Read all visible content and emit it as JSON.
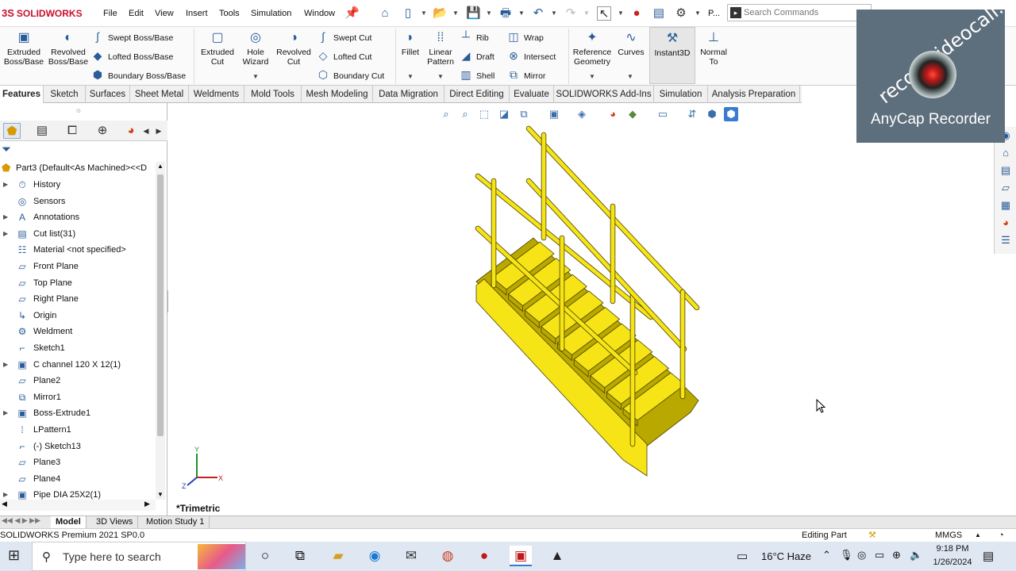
{
  "app": {
    "logo_prefix": "3S",
    "logo_text": "SOLIDWORKS"
  },
  "menu": [
    "File",
    "Edit",
    "View",
    "Insert",
    "Tools",
    "Simulation",
    "Window"
  ],
  "quick": {
    "truncated_label": "P...",
    "search_placeholder": "Search Commands"
  },
  "ribbon": {
    "extruded_boss": "Extruded\nBoss/Base",
    "revolved_boss": "Revolved\nBoss/Base",
    "swept_boss": "Swept Boss/Base",
    "lofted_boss": "Lofted Boss/Base",
    "boundary_boss": "Boundary Boss/Base",
    "extruded_cut": "Extruded\nCut",
    "hole_wizard": "Hole\nWizard",
    "revolved_cut": "Revolved\nCut",
    "swept_cut": "Swept Cut",
    "lofted_cut": "Lofted Cut",
    "boundary_cut": "Boundary Cut",
    "fillet": "Fillet",
    "linear_pattern": "Linear\nPattern",
    "rib": "Rib",
    "draft": "Draft",
    "shell": "Shell",
    "wrap": "Wrap",
    "intersect": "Intersect",
    "mirror": "Mirror",
    "reference_geometry": "Reference\nGeometry",
    "curves": "Curves",
    "instant3d": "Instant3D",
    "normal_to": "Normal\nTo"
  },
  "tabs": [
    "Features",
    "Sketch",
    "Surfaces",
    "Sheet Metal",
    "Weldments",
    "Mold Tools",
    "Mesh Modeling",
    "Data Migration",
    "Direct Editing",
    "Evaluate",
    "SOLIDWORKS Add-Ins",
    "Simulation",
    "Analysis Preparation"
  ],
  "active_tab": "Features",
  "tree": {
    "root": "Part3  (Default<As Machined><<D",
    "items": [
      {
        "label": "History",
        "expandable": true,
        "icon": "history-icon"
      },
      {
        "label": "Sensors",
        "expandable": false,
        "icon": "sensors-icon"
      },
      {
        "label": "Annotations",
        "expandable": true,
        "icon": "annotations-icon"
      },
      {
        "label": "Cut list(31)",
        "expandable": true,
        "icon": "cut-list-icon"
      },
      {
        "label": "Material <not specified>",
        "expandable": false,
        "icon": "material-icon"
      },
      {
        "label": "Front Plane",
        "expandable": false,
        "icon": "plane-icon"
      },
      {
        "label": "Top Plane",
        "expandable": false,
        "icon": "plane-icon"
      },
      {
        "label": "Right Plane",
        "expandable": false,
        "icon": "plane-icon"
      },
      {
        "label": "Origin",
        "expandable": false,
        "icon": "origin-icon"
      },
      {
        "label": "Weldment",
        "expandable": false,
        "icon": "weldment-icon"
      },
      {
        "label": "Sketch1",
        "expandable": false,
        "icon": "sketch-icon"
      },
      {
        "label": "C channel 120 X 12(1)",
        "expandable": true,
        "icon": "structural-member-icon"
      },
      {
        "label": "Plane2",
        "expandable": false,
        "icon": "plane-icon"
      },
      {
        "label": "Mirror1",
        "expandable": false,
        "icon": "mirror-icon"
      },
      {
        "label": "Boss-Extrude1",
        "expandable": true,
        "icon": "extrude-icon"
      },
      {
        "label": "LPattern1",
        "expandable": false,
        "icon": "linear-pattern-icon"
      },
      {
        "label": "(-) Sketch13",
        "expandable": false,
        "icon": "sketch-icon"
      },
      {
        "label": "Plane3",
        "expandable": false,
        "icon": "plane-icon"
      },
      {
        "label": "Plane4",
        "expandable": false,
        "icon": "plane-icon"
      },
      {
        "label": "Pipe DIA 25X2(1)",
        "expandable": true,
        "icon": "structural-member-icon"
      }
    ]
  },
  "viewport": {
    "view_label": "*Trimetric",
    "triad": {
      "y": "Y",
      "x": "X",
      "z": "Z"
    }
  },
  "bottom_tabs": [
    "Model",
    "3D Views",
    "Motion Study 1"
  ],
  "status": {
    "left": "SOLIDWORKS Premium 2021 SP0.0",
    "mode": "Editing Part",
    "units": "MMGS"
  },
  "watermark": {
    "url": "recordvideocall.com",
    "name": "AnyCap Recorder"
  },
  "taskbar": {
    "search": "Type here to search",
    "weather": "16°C  Haze",
    "time": "9:18 PM",
    "date": "1/26/2024"
  },
  "colors": {
    "stair": "#f6e416",
    "stair_shadow": "#b8a800",
    "accent_blue": "#2a5c9a"
  }
}
